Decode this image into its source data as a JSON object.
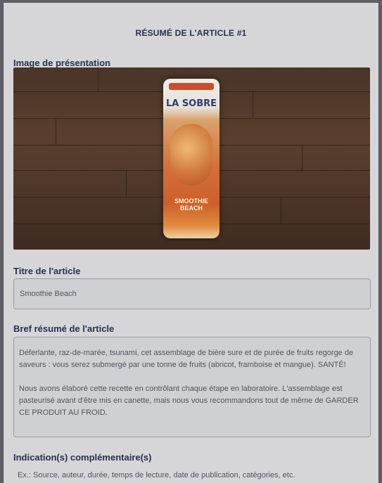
{
  "page": {
    "title": "RÉSUMÉ DE L'ARTICLE #1"
  },
  "image_section": {
    "label": "Image de présentation",
    "can_brand": "LA SOBRE",
    "can_label": "SMOOTHIE BEACH"
  },
  "article_title": {
    "label": "Titre de l'article",
    "value": "Smoothie Beach"
  },
  "summary": {
    "label": "Bref résumé de l'article",
    "paragraphs": [
      "Déferlante, raz-de-marée, tsunami, cet assemblage de bière sure et de purée de fruits regorge de saveurs : vous serez submergé par une tonne de fruits (abricot, framboise et mangue). SANTÉ!",
      "Nous avons élaboré cette recette en contrôlant chaque étape en laboratoire. L'assemblage est pasteurisé avant d'être mis en canette, mais nous vous recommandons tout de même de GARDER CE PRODUIT AU FROID."
    ]
  },
  "extra": {
    "label": "Indication(s) complémentaire(s)",
    "placeholder": "Ex.: Source, auteur, durée, temps de lecture, date de publication, catégories, etc."
  }
}
